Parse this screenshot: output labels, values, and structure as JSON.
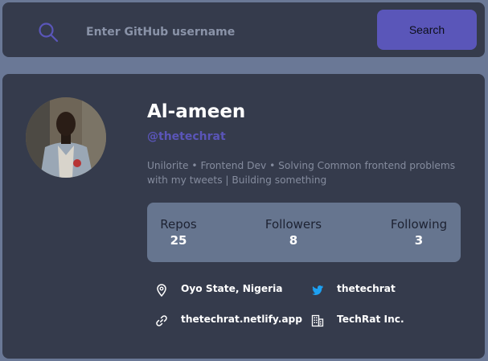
{
  "search": {
    "placeholder": "Enter GitHub username",
    "button_label": "Search"
  },
  "profile": {
    "name": "Al-ameen",
    "login": "@thetechrat",
    "bio": "Unilorite • Frontend Dev • Solving Common frontend problems with my tweets | Building something",
    "stats": [
      {
        "label": "Repos",
        "value": "25"
      },
      {
        "label": "Followers",
        "value": "8"
      },
      {
        "label": "Following",
        "value": "3"
      }
    ],
    "links": {
      "location": "Oyo State, Nigeria",
      "twitter": "thetechrat",
      "website": "thetechrat.netlify.app",
      "company": "TechRat Inc."
    }
  },
  "colors": {
    "background": "#6a7896",
    "panel": "#353b4c",
    "accent": "#5a56b9",
    "stats_panel": "#66758f"
  }
}
